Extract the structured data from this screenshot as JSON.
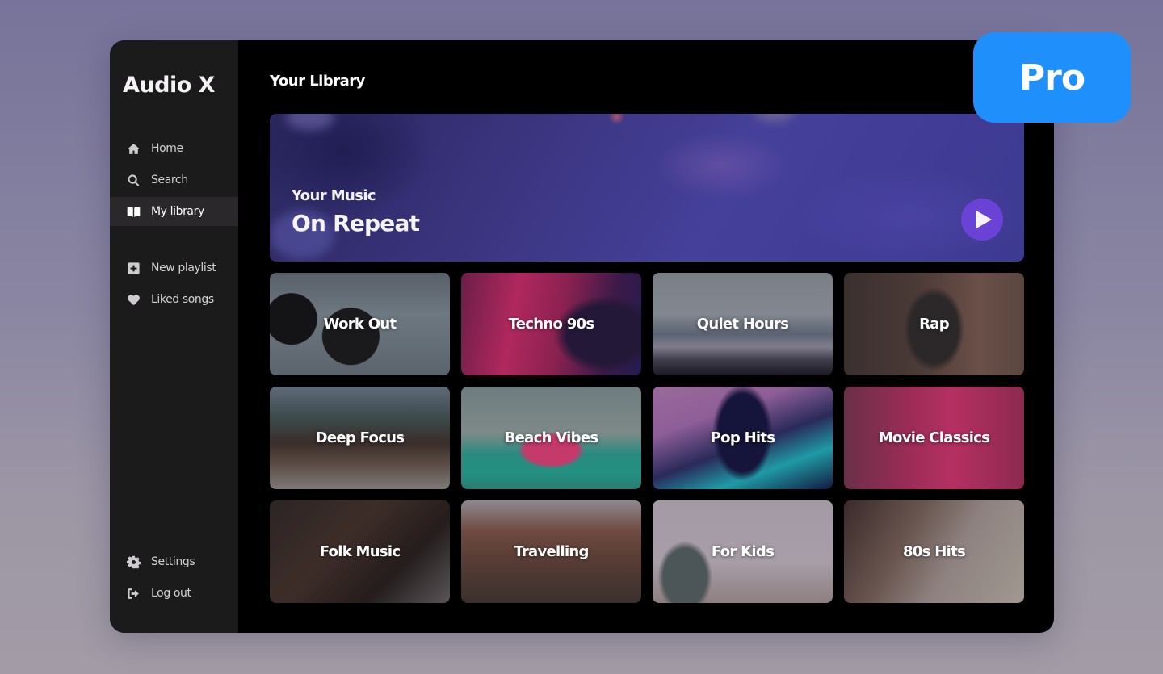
{
  "app": {
    "name": "Audio X"
  },
  "sidebar": {
    "main_items": [
      {
        "label": "Home",
        "icon": "home-icon",
        "active": false
      },
      {
        "label": "Search",
        "icon": "search-icon",
        "active": false
      },
      {
        "label": "My library",
        "icon": "book-icon",
        "active": true
      }
    ],
    "secondary_items": [
      {
        "label": "New playlist",
        "icon": "plus-square-icon"
      },
      {
        "label": "Liked songs",
        "icon": "heart-icon"
      }
    ],
    "bottom_items": [
      {
        "label": "Settings",
        "icon": "gear-icon"
      },
      {
        "label": "Log out",
        "icon": "logout-icon"
      }
    ]
  },
  "main": {
    "title": "Your Library",
    "hero": {
      "subtitle": "Your Music",
      "title": "On Repeat",
      "play_icon": "play-icon",
      "play_button_color": "#6a43d6"
    },
    "playlists": [
      {
        "label": "Work Out"
      },
      {
        "label": "Techno 90s"
      },
      {
        "label": "Quiet Hours"
      },
      {
        "label": "Rap"
      },
      {
        "label": "Deep Focus"
      },
      {
        "label": "Beach Vibes"
      },
      {
        "label": "Pop Hits"
      },
      {
        "label": "Movie Classics"
      },
      {
        "label": "Folk Music"
      },
      {
        "label": "Travelling"
      },
      {
        "label": "For Kids"
      },
      {
        "label": "80s Hits"
      }
    ]
  },
  "badge": {
    "label": "Pro",
    "color": "#1e8ffb"
  }
}
